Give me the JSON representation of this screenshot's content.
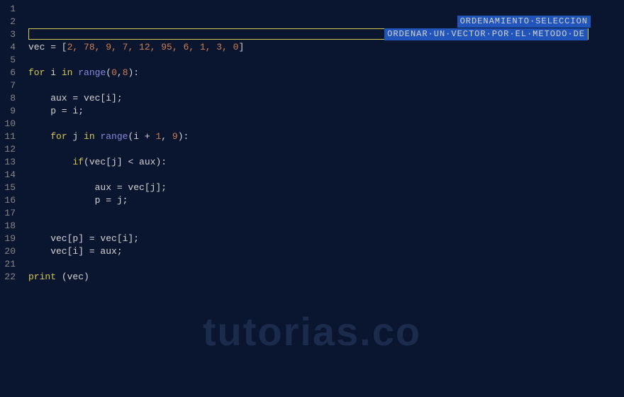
{
  "gutter": {
    "start": 1,
    "end": 22
  },
  "comment": {
    "line1": "ORDENAR·UN·VECTOR·POR·EL·METODO·DE",
    "line2": "ORDENAMIENTO·SELECCION"
  },
  "code": {
    "l4": {
      "var": "vec",
      "eq": " = [",
      "nums": "2, 78, 9, 7, 12, 95, 6, 1, 3, 0",
      "close": "]"
    },
    "l6": {
      "for": "for",
      "i": " i ",
      "in": "in",
      "sp": " ",
      "range": "range",
      "args": "(",
      "n1": "0",
      "comma": ",",
      "n2": "8",
      "close": "):"
    },
    "l8": {
      "text": "    aux = vec[i];"
    },
    "l9": {
      "text": "    p = i;"
    },
    "l11": {
      "indent": "    ",
      "for": "for",
      "j": " j ",
      "in": "in",
      "sp": " ",
      "range": "range",
      "open": "(i + ",
      "n1": "1",
      "mid": ", ",
      "n2": "9",
      "close": "):"
    },
    "l13": {
      "indent": "        ",
      "if": "if",
      "rest": "(vec[j] < aux):"
    },
    "l15": {
      "text": "            aux = vec[j];"
    },
    "l16": {
      "text": "            p = j;"
    },
    "l19": {
      "text": "    vec[p] = vec[i];"
    },
    "l20": {
      "text": "    vec[i] = aux;"
    },
    "l22": {
      "print": "print",
      "rest": " (vec)"
    }
  },
  "watermark": "tutorias.co"
}
